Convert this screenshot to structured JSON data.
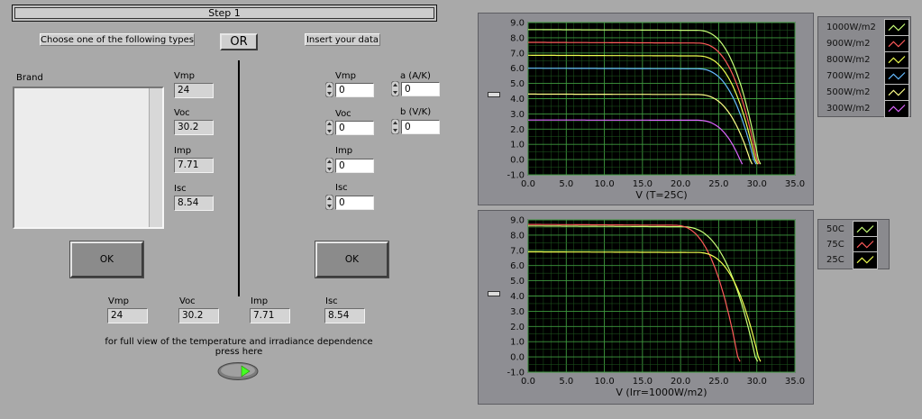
{
  "header": {
    "step_title": "Step 1"
  },
  "left": {
    "choose_label": "Choose one of the following types",
    "or_label": "OR",
    "insert_label": "Insert your data",
    "brand_label": "Brand",
    "brand_items": [],
    "specs": [
      {
        "label": "Vmp",
        "value": "24"
      },
      {
        "label": "Voc",
        "value": "30.2"
      },
      {
        "label": "Imp",
        "value": "7.71"
      },
      {
        "label": "Isc",
        "value": "8.54"
      }
    ],
    "ok_left": "OK",
    "ok_right": "OK",
    "inputs": [
      {
        "label": "Vmp",
        "value": "0"
      },
      {
        "label": "Voc",
        "value": "0"
      },
      {
        "label": "Imp",
        "value": "0"
      },
      {
        "label": "Isc",
        "value": "0"
      }
    ],
    "coeffs": [
      {
        "label": "a (A/K)",
        "value": "0"
      },
      {
        "label": "b  (V/K)",
        "value": "0"
      }
    ],
    "result": [
      {
        "label": "Vmp",
        "value": "24"
      },
      {
        "label": "Voc",
        "value": "30.2"
      },
      {
        "label": "Imp",
        "value": "7.71"
      },
      {
        "label": "Isc",
        "value": "8.54"
      }
    ],
    "note_line1": "for full view of the  temperature and irradiance dependence",
    "note_line2": "press here"
  },
  "chart_data": [
    {
      "type": "line",
      "xlabel": "V (T=25C)",
      "ylabel": "",
      "xlim": [
        0,
        35
      ],
      "ylim": [
        -1,
        9
      ],
      "xticks": [
        "0.0",
        "5.0",
        "10.0",
        "15.0",
        "20.0",
        "25.0",
        "30.0",
        "35.0"
      ],
      "yticks": [
        "-1.0",
        "0.0",
        "1.0",
        "2.0",
        "3.0",
        "4.0",
        "5.0",
        "6.0",
        "7.0",
        "8.0",
        "9.0"
      ],
      "grid": true,
      "legend_position": "right",
      "series": [
        {
          "name": "1000W/m2",
          "color": "#c8ff78",
          "isc": 8.54,
          "voc": 30.2,
          "knee": 22.0
        },
        {
          "name": "900W/m2",
          "color": "#ff5a5a",
          "isc": 7.7,
          "voc": 30.0,
          "knee": 22.0
        },
        {
          "name": "800W/m2",
          "color": "#f0ff50",
          "isc": 6.85,
          "voc": 29.8,
          "knee": 22.0
        },
        {
          "name": "700W/m2",
          "color": "#66bbff",
          "isc": 6.0,
          "voc": 29.6,
          "knee": 22.0
        },
        {
          "name": "500W/m2",
          "color": "#ffff88",
          "isc": 4.3,
          "voc": 29.1,
          "knee": 22.0
        },
        {
          "name": "300W/m2",
          "color": "#dd66ff",
          "isc": 2.6,
          "voc": 27.8,
          "knee": 22.0
        }
      ]
    },
    {
      "type": "line",
      "xlabel": "V (Irr=1000W/m2)",
      "ylabel": "",
      "xlim": [
        0,
        35
      ],
      "ylim": [
        -1,
        9
      ],
      "xticks": [
        "0.0",
        "5.0",
        "10.0",
        "15.0",
        "20.0",
        "25.0",
        "30.0",
        "35.0"
      ],
      "yticks": [
        "-1.0",
        "0.0",
        "1.0",
        "2.0",
        "3.0",
        "4.0",
        "5.0",
        "6.0",
        "7.0",
        "8.0",
        "9.0"
      ],
      "grid": true,
      "legend_position": "right",
      "series": [
        {
          "name": "50C",
          "color": "#c8ff78",
          "isc": 8.6,
          "voc": 29.8,
          "knee": 20.0
        },
        {
          "name": "75C",
          "color": "#ff5a5a",
          "isc": 8.7,
          "voc": 27.5,
          "knee": 19.0
        },
        {
          "name": "25C",
          "color": "#f0ff50",
          "isc": 6.9,
          "voc": 30.2,
          "knee": 22.0
        }
      ]
    }
  ]
}
